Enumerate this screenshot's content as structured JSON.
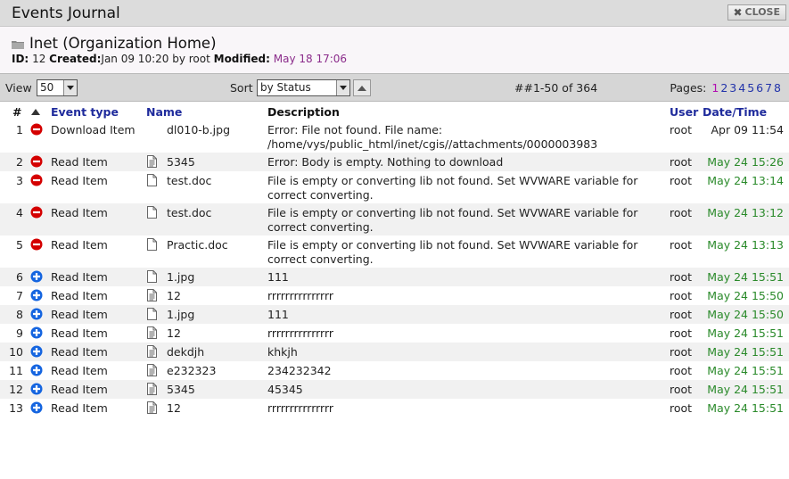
{
  "window": {
    "title": "Events Journal",
    "close_label": "CLOSE"
  },
  "header": {
    "org_title": "Inet (Organization Home)",
    "id_label": "ID:",
    "id_value": "12",
    "created_label": "Created:",
    "created_value": "Jan 09 10:20 by root",
    "modified_label": "Modified:",
    "modified_value": "May 18 17:06"
  },
  "toolbar": {
    "view_label": "View",
    "view_value": "50",
    "sort_label": "Sort",
    "sort_value": "by Status",
    "range_text": "##1-50 of 364",
    "pages_label": "Pages:",
    "pages": [
      "1",
      "2",
      "3",
      "4",
      "5",
      "6",
      "7",
      "8"
    ],
    "current_page": "1"
  },
  "columns": {
    "num": "#",
    "event_type": "Event type",
    "name": "Name",
    "description": "Description",
    "user": "User",
    "datetime": "Date/Time"
  },
  "colors": {
    "error": "#d40000",
    "info": "#1565e0",
    "date_green": "#2a8a2a",
    "link_blue": "#1f2b9c",
    "page_current": "#b10bb1"
  },
  "rows": [
    {
      "num": "1",
      "status": "error",
      "type": "Download Item",
      "file_icon": "none",
      "name": "dl010-b.jpg",
      "desc": "Error: File not found. File name: /home/vys/public_html/inet/cgis//attachments/0000003983",
      "user": "root",
      "date": "Apr 09 11:54",
      "date_style": "dark"
    },
    {
      "num": "2",
      "status": "error",
      "type": "Read Item",
      "file_icon": "text",
      "name": "5345",
      "desc": "Error: Body is empty. Nothing to download",
      "user": "root",
      "date": "May 24 15:26",
      "date_style": "green"
    },
    {
      "num": "3",
      "status": "error",
      "type": "Read Item",
      "file_icon": "blank",
      "name": "test.doc",
      "desc": "File is empty or converting lib not found. Set WVWARE variable for correct converting.",
      "user": "root",
      "date": "May 24 13:14",
      "date_style": "green"
    },
    {
      "num": "4",
      "status": "error",
      "type": "Read Item",
      "file_icon": "blank",
      "name": "test.doc",
      "desc": "File is empty or converting lib not found. Set WVWARE variable for correct converting.",
      "user": "root",
      "date": "May 24 13:12",
      "date_style": "green"
    },
    {
      "num": "5",
      "status": "error",
      "type": "Read Item",
      "file_icon": "blank",
      "name": "Practic.doc",
      "desc": "File is empty or converting lib not found. Set WVWARE variable for correct converting.",
      "user": "root",
      "date": "May 24 13:13",
      "date_style": "green"
    },
    {
      "num": "6",
      "status": "info",
      "type": "Read Item",
      "file_icon": "blank",
      "name": "1.jpg",
      "desc": "111",
      "user": "root",
      "date": "May 24 15:51",
      "date_style": "green"
    },
    {
      "num": "7",
      "status": "info",
      "type": "Read Item",
      "file_icon": "text",
      "name": "12",
      "desc": "rrrrrrrrrrrrrrr",
      "user": "root",
      "date": "May 24 15:50",
      "date_style": "green"
    },
    {
      "num": "8",
      "status": "info",
      "type": "Read Item",
      "file_icon": "blank",
      "name": "1.jpg",
      "desc": "111",
      "user": "root",
      "date": "May 24 15:50",
      "date_style": "green"
    },
    {
      "num": "9",
      "status": "info",
      "type": "Read Item",
      "file_icon": "text",
      "name": "12",
      "desc": "rrrrrrrrrrrrrrr",
      "user": "root",
      "date": "May 24 15:51",
      "date_style": "green"
    },
    {
      "num": "10",
      "status": "info",
      "type": "Read Item",
      "file_icon": "text",
      "name": "dekdjh",
      "desc": "khkjh",
      "user": "root",
      "date": "May 24 15:51",
      "date_style": "green"
    },
    {
      "num": "11",
      "status": "info",
      "type": "Read Item",
      "file_icon": "text",
      "name": "e232323",
      "desc": "234232342",
      "user": "root",
      "date": "May 24 15:51",
      "date_style": "green"
    },
    {
      "num": "12",
      "status": "info",
      "type": "Read Item",
      "file_icon": "text",
      "name": "5345",
      "desc": "45345",
      "user": "root",
      "date": "May 24 15:51",
      "date_style": "green"
    },
    {
      "num": "13",
      "status": "info",
      "type": "Read Item",
      "file_icon": "text",
      "name": "12",
      "desc": "rrrrrrrrrrrrrrr",
      "user": "root",
      "date": "May 24 15:51",
      "date_style": "green"
    }
  ]
}
